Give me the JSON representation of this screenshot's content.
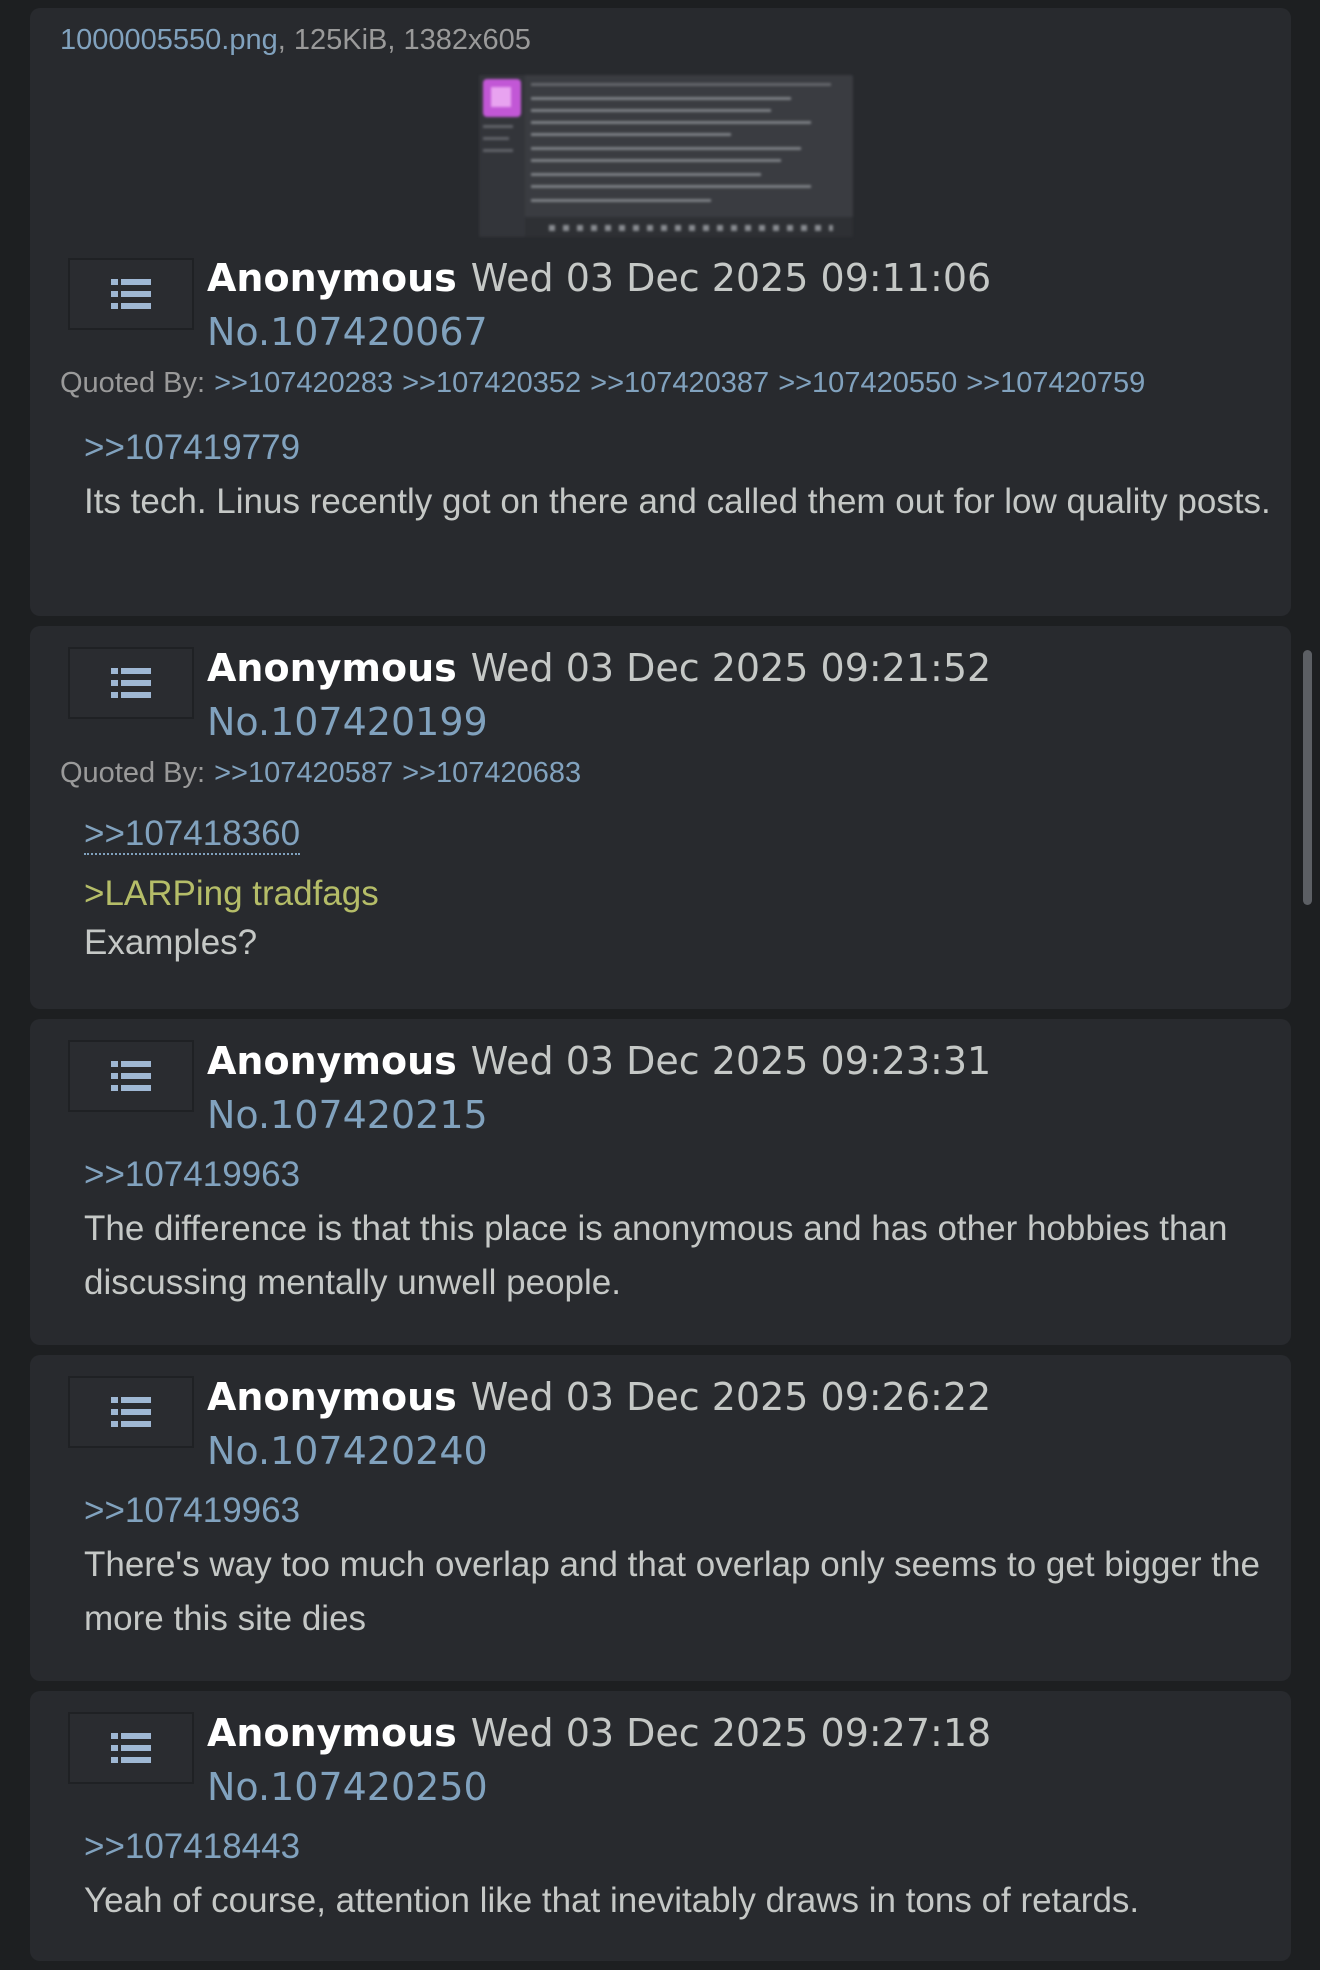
{
  "file": {
    "name": "1000005550.png",
    "meta": ", 125KiB, 1382x605"
  },
  "posts": [
    {
      "name": "Anonymous",
      "date": "Wed 03 Dec 2025 09:11:06",
      "number": "No.107420067",
      "quoted_by_label": "Quoted By:",
      "quoted_by": [
        ">>107420283",
        ">>107420352",
        ">>107420387",
        ">>107420550",
        ">>107420759"
      ],
      "reply_to": ">>107419779",
      "comment": "Its tech. Linus recently got on there and called them out for low quality posts."
    },
    {
      "name": "Anonymous",
      "date": "Wed 03 Dec 2025 09:21:52",
      "number": "No.107420199",
      "quoted_by_label": "Quoted By:",
      "quoted_by": [
        ">>107420587",
        ">>107420683"
      ],
      "reply_to": ">>107418360",
      "greentext": ">LARPing tradfags",
      "comment": "Examples?"
    },
    {
      "name": "Anonymous",
      "date": "Wed 03 Dec 2025 09:23:31",
      "number": "No.107420215",
      "reply_to": ">>107419963",
      "comment": "The difference is that this place is anonymous and has other hobbies than discussing mentally unwell people."
    },
    {
      "name": "Anonymous",
      "date": "Wed 03 Dec 2025 09:26:22",
      "number": "No.107420240",
      "reply_to": ">>107419963",
      "comment": "There's way too much overlap and that overlap only seems to get bigger the more this site dies"
    },
    {
      "name": "Anonymous",
      "date": "Wed 03 Dec 2025 09:27:18",
      "number": "No.107420250",
      "reply_to": ">>107418443",
      "comment": "Yeah of course, attention like that inevitably draws in tons of retards."
    }
  ],
  "icons": {
    "post_menu": "list-icon",
    "thumbnail": "image-thumbnail"
  },
  "colors": {
    "background": "#1d1f21",
    "post_background": "#282a2e",
    "link": "#81a2be",
    "text": "#c5c8c6",
    "greentext": "#b5bd68",
    "name": "#ffffff"
  }
}
